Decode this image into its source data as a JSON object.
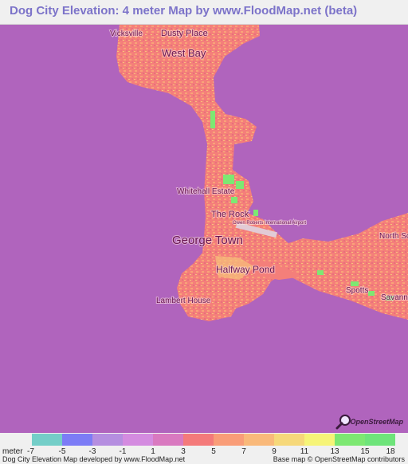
{
  "title": "Dog City Elevation: 4 meter Map by www.FloodMap.net (beta)",
  "map": {
    "places": [
      {
        "name": "Vicksville"
      },
      {
        "name": "Dusty Place"
      },
      {
        "name": "West Bay"
      },
      {
        "name": "Whitehall Estate"
      },
      {
        "name": "The Rock"
      },
      {
        "name": "Owen Roberts International Airport"
      },
      {
        "name": "George Town"
      },
      {
        "name": "Halfway Pond"
      },
      {
        "name": "North Sound Estates"
      },
      {
        "name": "Lambert House"
      },
      {
        "name": "Spotts"
      },
      {
        "name": "Savannah"
      }
    ],
    "colors": {
      "sea": "#b064bd",
      "land": "#f47f7a"
    },
    "attribution_logo": "OpenStreetMap",
    "logo_icon": "magnifier-icon"
  },
  "legend": {
    "unit": "meter",
    "colors": [
      "#74cec8",
      "#7c7cf6",
      "#b58ee0",
      "#d48be0",
      "#d979c0",
      "#f47a7a",
      "#f99d78",
      "#f9b97a",
      "#f6d87a",
      "#f6f478",
      "#7de872",
      "#6ee47a"
    ],
    "ticks": [
      "-7",
      "-5",
      "-3",
      "-1",
      "1",
      "3",
      "5",
      "7",
      "9",
      "11",
      "13",
      "15",
      "18"
    ]
  },
  "credits": {
    "left": "Dog City Elevation Map developed by www.FloodMap.net",
    "right": "Base map © OpenStreetMap contributors"
  }
}
